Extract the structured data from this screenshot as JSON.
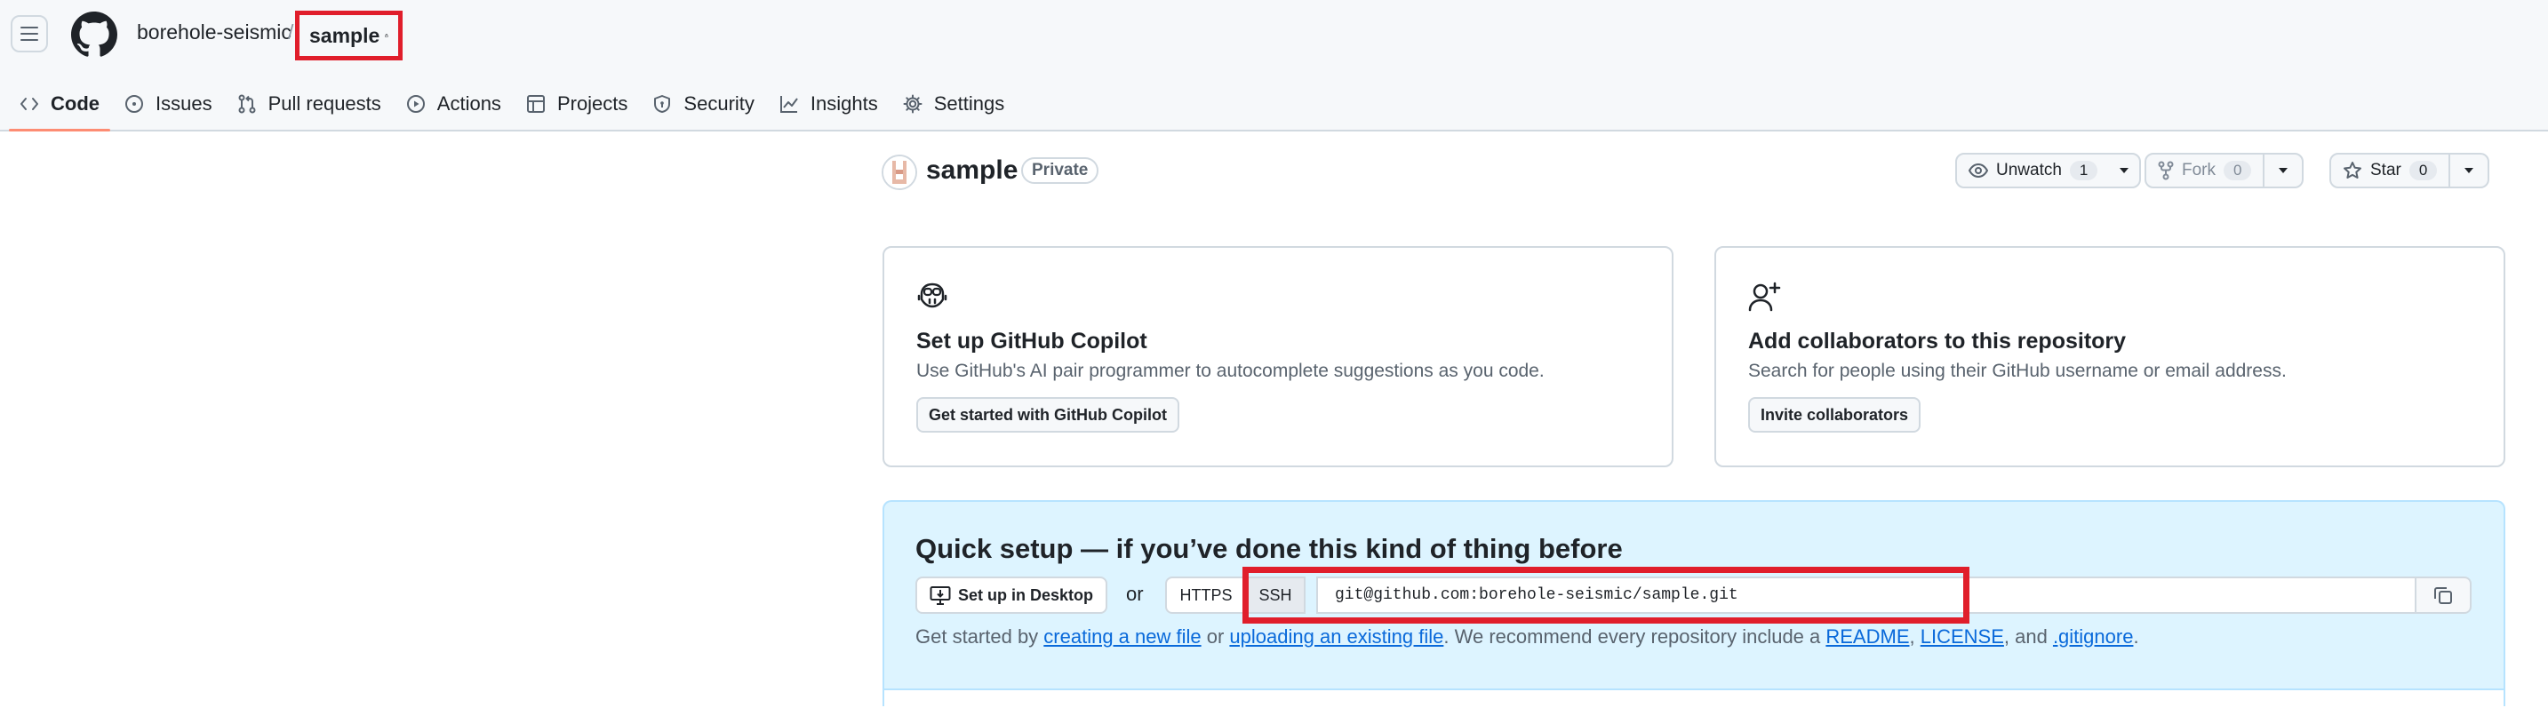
{
  "header": {
    "menu_icon": "hamburger-icon",
    "logo_icon": "github-logo-icon",
    "owner": "borehole-seismic",
    "separator": "/",
    "repo": "sample",
    "lock_icon": "lock-icon"
  },
  "tabs": [
    {
      "label": "Code",
      "icon": "code-icon",
      "active": true
    },
    {
      "label": "Issues",
      "icon": "issue-opened-icon"
    },
    {
      "label": "Pull requests",
      "icon": "git-pull-request-icon"
    },
    {
      "label": "Actions",
      "icon": "play-icon"
    },
    {
      "label": "Projects",
      "icon": "table-icon"
    },
    {
      "label": "Security",
      "icon": "shield-icon"
    },
    {
      "label": "Insights",
      "icon": "graph-icon"
    },
    {
      "label": "Settings",
      "icon": "gear-icon"
    }
  ],
  "repo": {
    "name": "sample",
    "visibility": "Private",
    "watch_label": "Unwatch",
    "watch_count": "1",
    "fork_label": "Fork",
    "fork_count": "0",
    "star_label": "Star",
    "star_count": "0"
  },
  "copilot_card": {
    "icon": "copilot-icon",
    "title": "Set up GitHub Copilot",
    "description": "Use GitHub's AI pair programmer to autocomplete suggestions as you code.",
    "button": "Get started with GitHub Copilot"
  },
  "collab_card": {
    "icon": "person-add-icon",
    "title": "Add collaborators to this repository",
    "description": "Search for people using their GitHub username or email address.",
    "button": "Invite collaborators"
  },
  "quick_setup": {
    "title": "Quick setup — if you’ve done this kind of thing before",
    "desktop_button": "Set up in Desktop",
    "or": "or",
    "https": "HTTPS",
    "ssh": "SSH",
    "clone_url": "git@github.com:borehole-seismic/sample.git",
    "line_prefix": "Get started by ",
    "link_new_file": "creating a new file",
    "text_or": " or ",
    "link_upload": "uploading an existing file",
    "text_recommend": ". We recommend every repository include a ",
    "link_readme": "README",
    "text_comma1": ", ",
    "link_license": "LICENSE",
    "text_and": ", and ",
    "link_gitignore": ".gitignore",
    "text_end": "."
  },
  "colors": {
    "highlight": "#e01e2b",
    "link": "#0969da",
    "quick_setup_bg": "#ddf4ff",
    "active_tab_underline": "#fd8c73"
  }
}
